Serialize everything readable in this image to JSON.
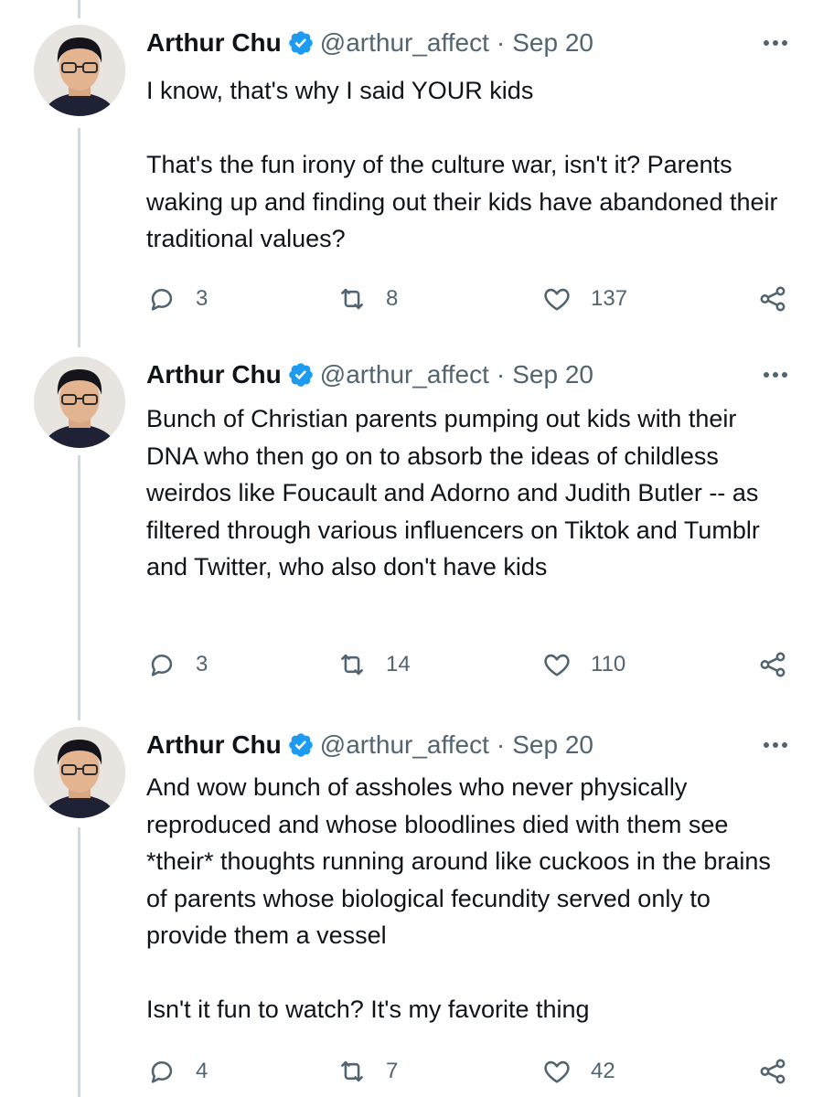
{
  "colors": {
    "verified": "#1d9bf0",
    "text": "#0f1419",
    "muted": "#536471",
    "thread_line": "#cfd9de"
  },
  "icons": [
    "reply-icon",
    "retweet-icon",
    "like-icon",
    "share-icon",
    "verified-badge-icon",
    "more-options-icon"
  ],
  "tweets": [
    {
      "name": "Arthur Chu",
      "handle": "@arthur_affect",
      "sep": "·",
      "date": "Sep 20",
      "paragraphs": [
        "I know, that's why I said YOUR kids",
        "That's the fun irony of the culture war, isn't it? Parents waking up and finding out their kids have abandoned their traditional values?"
      ],
      "replies": "3",
      "retweets": "8",
      "likes": "137"
    },
    {
      "name": "Arthur Chu",
      "handle": "@arthur_affect",
      "sep": "·",
      "date": "Sep 20",
      "paragraphs": [
        "Bunch of Christian parents pumping out kids with their DNA who then go on to absorb the ideas of childless weirdos like Foucault and Adorno and Judith Butler -- as filtered through various influencers on Tiktok and Tumblr and Twitter, who also don't have kids"
      ],
      "replies": "3",
      "retweets": "14",
      "likes": "110"
    },
    {
      "name": "Arthur Chu",
      "handle": "@arthur_affect",
      "sep": "·",
      "date": "Sep 20",
      "paragraphs": [
        "And wow bunch of assholes who never physically reproduced and whose bloodlines died with them see *their* thoughts running around like cuckoos in the brains of parents whose biological fecundity served only to provide them a vessel",
        "Isn't it fun to watch? It's my favorite thing"
      ],
      "replies": "4",
      "retweets": "7",
      "likes": "42"
    }
  ]
}
